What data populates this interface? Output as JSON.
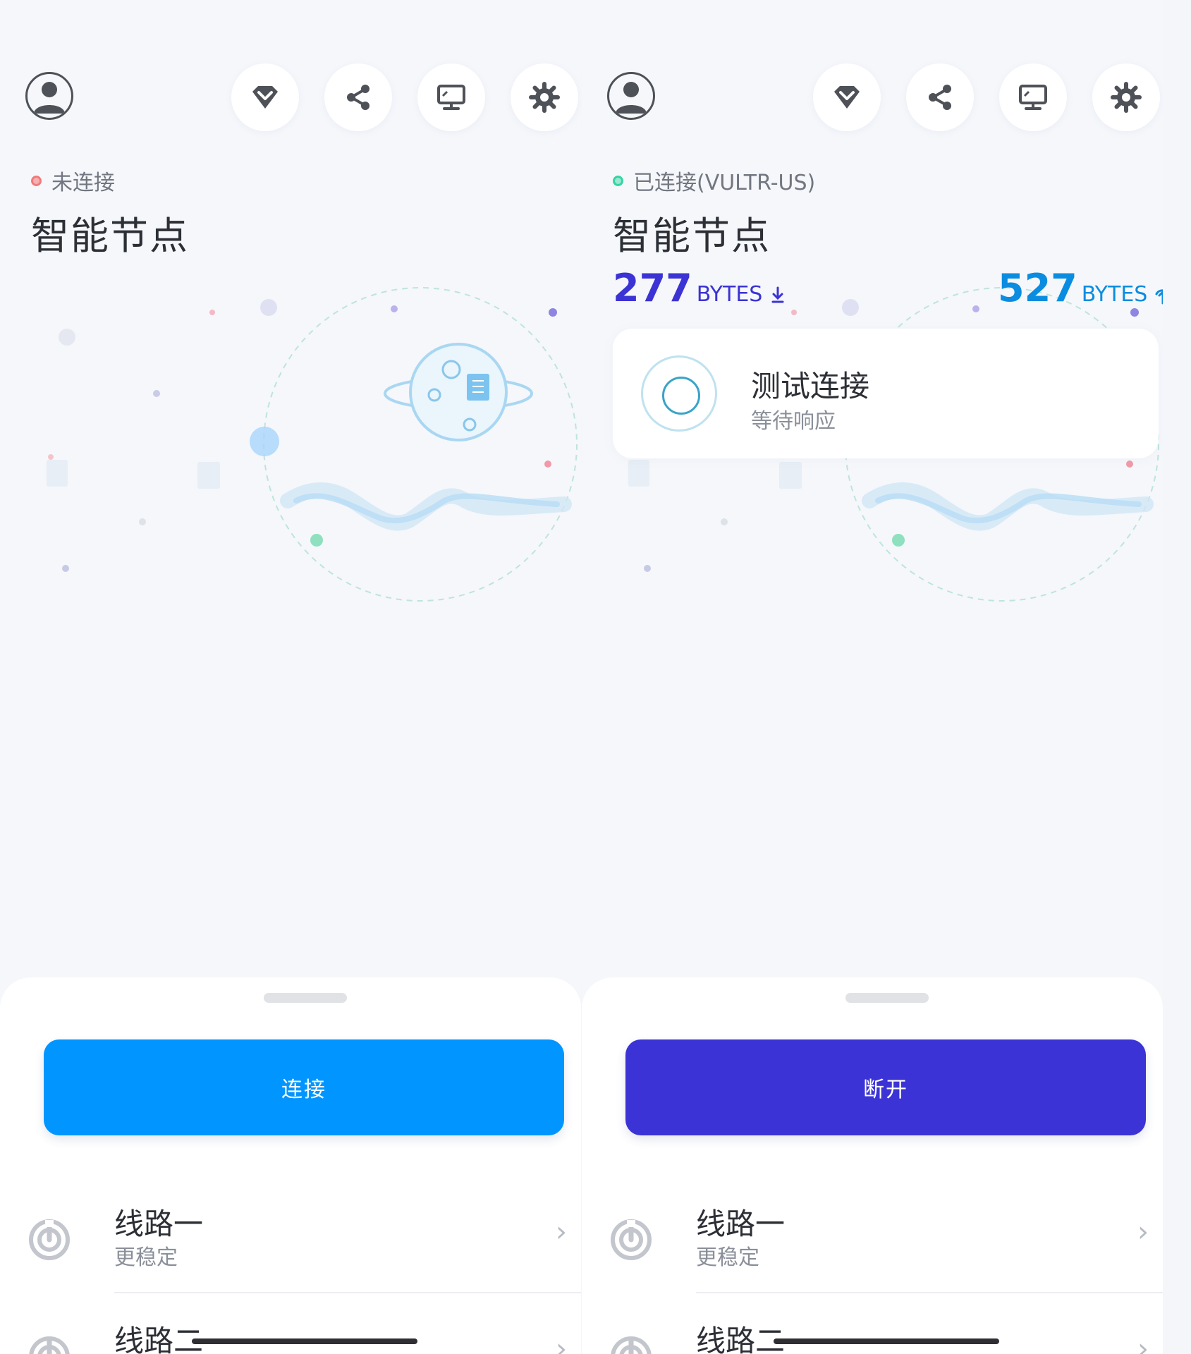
{
  "left": {
    "status_text": "未连接",
    "status_color": "#f07b7b",
    "title": "智能节点",
    "button_label": "连接",
    "button_color": "#0095ff",
    "routes": [
      {
        "title": "线路一",
        "subtitle": "更稳定",
        "arrow": "›"
      },
      {
        "title": "线路二",
        "arrow": "›"
      }
    ]
  },
  "right": {
    "status_text": "已连接(VULTR-US)",
    "status_color": "#34d4a4",
    "title": "智能节点",
    "download": {
      "value": "277",
      "unit": "BYTES",
      "color": "#3b33d4",
      "icon": "download-arrow-icon"
    },
    "upload": {
      "value": "527",
      "unit": "BYTES",
      "color": "#0a8de0",
      "icon": "upload-arrow-icon"
    },
    "test_card": {
      "title": "测试连接",
      "subtitle": "等待响应"
    },
    "button_label": "断开",
    "button_color": "#3b33d6",
    "routes": [
      {
        "title": "线路一",
        "subtitle": "更稳定",
        "arrow": "›"
      },
      {
        "title": "线路二",
        "arrow": "›"
      }
    ]
  },
  "toolbar_icons": [
    "diamond-icon",
    "share-icon",
    "monitor-icon",
    "gear-icon"
  ],
  "accent_colors": {
    "connect": "#0095ff",
    "disconnect": "#3b33d6",
    "connected": "#34d4a4",
    "disconnected": "#f07b7b"
  }
}
